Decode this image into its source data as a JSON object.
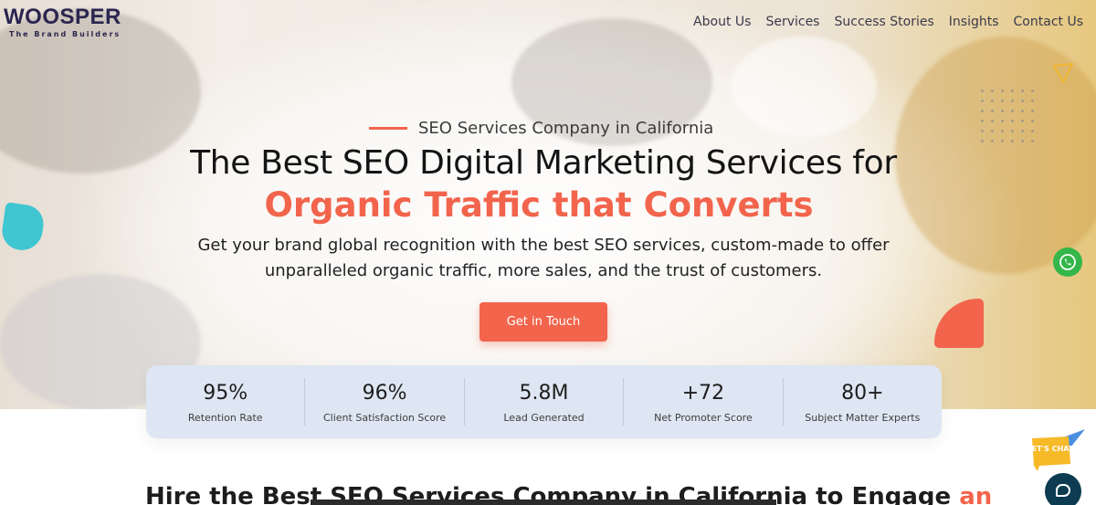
{
  "brand": {
    "name": "WOOSPER",
    "tagline": "The Brand Builders"
  },
  "nav": {
    "items": [
      "About Us",
      "Services",
      "Success Stories",
      "Insights",
      "Contact Us"
    ]
  },
  "hero": {
    "eyebrow": "SEO Services Company in California",
    "headline": "The Best SEO Digital Marketing Services for",
    "headline_accent": "Organic Traffic that Converts",
    "subtitle_line1": "Get your brand global recognition with the best SEO services, custom-made to offer",
    "subtitle_line2": "unparalleled organic traffic, more sales, and the trust of customers.",
    "cta_label": "Get in Touch"
  },
  "stats": [
    {
      "value": "95%",
      "label": "Retention Rate"
    },
    {
      "value": "96%",
      "label": "Client Satisfaction Score"
    },
    {
      "value": "5.8M",
      "label": "Lead Generated"
    },
    {
      "value": "+72",
      "label": "Net Promoter Score"
    },
    {
      "value": "80+",
      "label": "Subject Matter Experts"
    }
  ],
  "section": {
    "heading": "Hire the Best SEO Services Company in California to Engage",
    "heading_accent": "an"
  },
  "widgets": {
    "chat_badge": "LET'S CHAT"
  },
  "colors": {
    "accent": "#f2644c",
    "brand": "#2b2550",
    "stats_bg": "#dde6f2",
    "teal": "#3fc6d1",
    "whatsapp": "#34b64a",
    "chat": "#0d3b52"
  },
  "icons": [
    "whatsapp-icon",
    "chat-icon",
    "lets-chat-icon",
    "triangle-outline-icon"
  ]
}
